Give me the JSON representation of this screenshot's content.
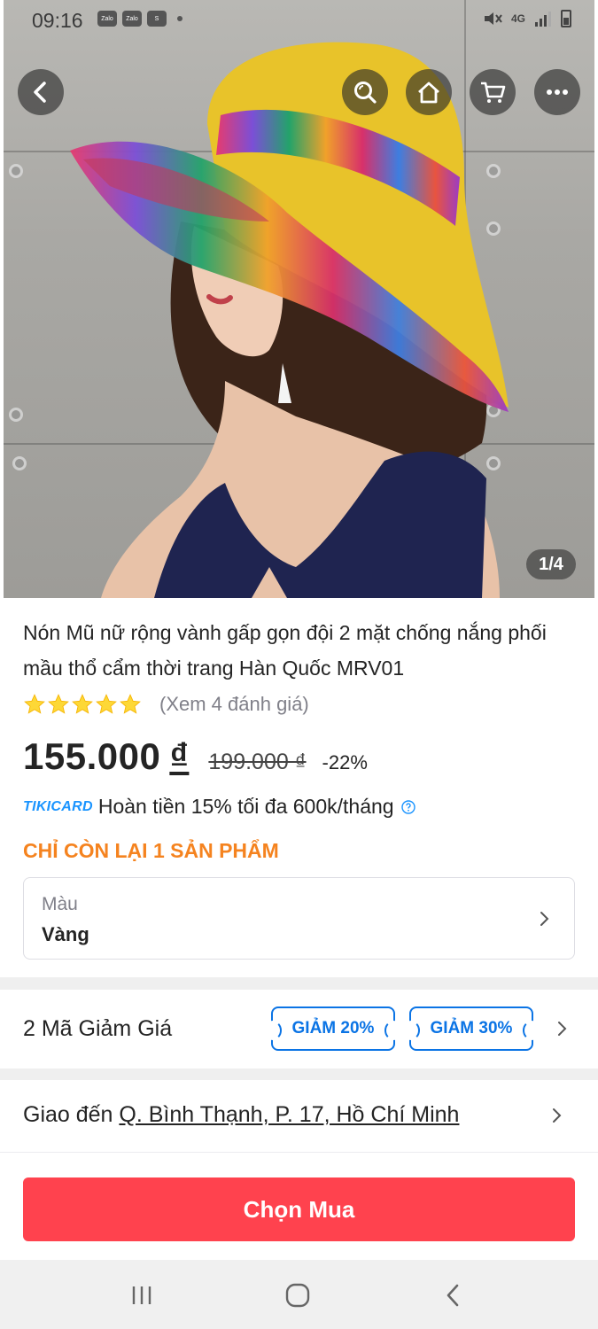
{
  "status_bar": {
    "time": "09:16",
    "left_icons": [
      "zalo-icon",
      "zalo-icon",
      "shopee-icon",
      "dot-icon"
    ],
    "right_icons": [
      "mute-icon",
      "4g-icon",
      "signal-icon",
      "battery-icon"
    ],
    "network": "4G"
  },
  "gallery": {
    "counter": "1/4",
    "image_description_icon": "product-photo",
    "buttons": [
      "back-icon",
      "search-icon",
      "home-icon",
      "cart-icon",
      "more-icon"
    ]
  },
  "product": {
    "title": "Nón Mũ nữ rộng vành gấp gọn đội 2 mặt chống nắng phối mầu thổ cẩm thời trang Hàn Quốc MRV01",
    "rating_stars": 5,
    "rating_link": "(Xem 4 đánh giá)",
    "price": "155.000",
    "currency": "₫",
    "old_price": "199.000 ₫",
    "discount": "-22%",
    "tikicard_logo": "TIKICARD",
    "tikicard_text": "Hoàn tiền 15% tối đa 600k/tháng",
    "stock_note": "CHỈ CÒN LẠI 1 SẢN PHẨM",
    "variant": {
      "label": "Màu",
      "value": "Vàng"
    }
  },
  "coupons": {
    "title": "2 Mã Giảm Giá",
    "items": [
      "GIẢM 20%",
      "GIẢM 30%"
    ]
  },
  "shipping": {
    "prefix": "Giao đến",
    "address": "Q. Bình Thạnh, P. 17, Hồ Chí Minh"
  },
  "actions": {
    "buy_label": "Chọn Mua"
  },
  "colors": {
    "accent_blue": "#0b74e5",
    "buy_red": "#ff424e",
    "stock_orange": "#f5831f",
    "star_yellow": "#fdd836"
  }
}
